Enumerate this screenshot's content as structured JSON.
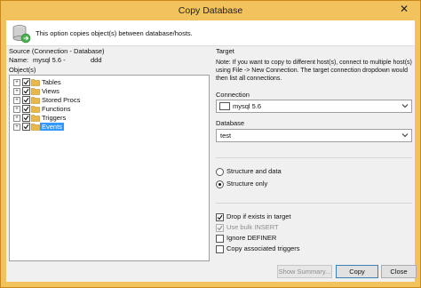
{
  "window": {
    "title": "Copy Database",
    "close_glyph": "✕"
  },
  "header": {
    "description": "This option copies object(s) between database/hosts."
  },
  "source": {
    "section_label": "Source (Connection - Database)",
    "name_label": "Name:",
    "connection": "mysql 5.6 -",
    "database": "ddd"
  },
  "objects": {
    "label": "Object(s)",
    "items": [
      {
        "label": "Tables",
        "checked": true,
        "selected": false
      },
      {
        "label": "Views",
        "checked": true,
        "selected": false
      },
      {
        "label": "Stored Procs",
        "checked": true,
        "selected": false
      },
      {
        "label": "Functions",
        "checked": true,
        "selected": false
      },
      {
        "label": "Triggers",
        "checked": true,
        "selected": false
      },
      {
        "label": "Events",
        "checked": true,
        "selected": true
      }
    ],
    "expander_glyph": "+"
  },
  "target": {
    "section_label": "Target",
    "note": "Note: If you want to copy to different host(s), connect to multiple host(s) using  File -> New Connection. The target connection dropdown would then list all connections.",
    "connection_label": "Connection",
    "connection_value": "mysql 5.6",
    "database_label": "Database",
    "database_value": "test"
  },
  "copy_mode": {
    "structure_and_data": {
      "label": "Structure and data",
      "selected": false
    },
    "structure_only": {
      "label": "Structure only",
      "selected": true
    }
  },
  "options": {
    "drop_if_exists": {
      "label": "Drop if exists in target",
      "checked": true,
      "disabled": false
    },
    "bulk_insert": {
      "label": "Use bulk INSERT",
      "checked": true,
      "disabled": true
    },
    "ignore_definer": {
      "label": "Ignore DEFINER",
      "checked": false,
      "disabled": false
    },
    "copy_triggers": {
      "label": "Copy associated triggers",
      "checked": false,
      "disabled": false
    }
  },
  "buttons": {
    "show_summary": "Show Summary...",
    "copy": "Copy",
    "close": "Close"
  },
  "colors": {
    "titlebar": "#f2c35d",
    "selection": "#3399ff",
    "folder": "#e8b84a"
  }
}
